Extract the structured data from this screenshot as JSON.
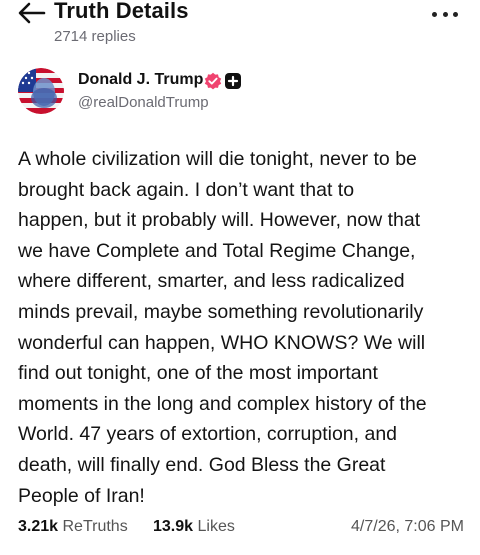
{
  "header": {
    "title": "Truth Details",
    "replies": "2714 replies"
  },
  "author": {
    "name": "Donald J. Trump",
    "handle": "@realDonaldTrump"
  },
  "post": {
    "lines": [
      "A whole civilization will die tonight, never to be",
      "brought back again. I don’t want that to",
      "happen, but it probably will. However, now that",
      "we have Complete and Total Regime Change,",
      "where different, smarter, and less radicalized",
      "minds prevail, maybe something revolutionarily",
      "wonderful can happen, WHO KNOWS? We will",
      "find out tonight, one of the most important",
      "moments in the long and complex history of the",
      "World. 47 years of extortion, corruption, and",
      "death, will finally end. God Bless the Great",
      "People of Iran!"
    ]
  },
  "stats": {
    "retruths_count": "3.21k",
    "retruths_label": "ReTruths",
    "likes_count": "13.9k",
    "likes_label": "Likes",
    "timestamp": "4/7/26, 7:06 PM"
  },
  "icons": {
    "back": "arrow-left-icon",
    "more": "more-horizontal-icon",
    "verified": "verified-badge-icon",
    "plus": "plus-badge-icon"
  },
  "colors": {
    "verified_badge": "#f0436f",
    "secondary_text": "#6b6b73",
    "primary_text": "#111111"
  }
}
